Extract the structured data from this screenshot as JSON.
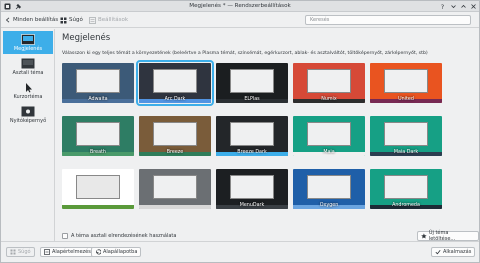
{
  "window": {
    "title": "Megjelenés * — Rendszerbeállítások"
  },
  "toolbar": {
    "back_label": "Minden beállítás",
    "help_label": "Súgó",
    "settings_label": "Beállítások",
    "search_placeholder": "Keresés"
  },
  "sidebar": {
    "items": [
      {
        "label": "Megjelenés",
        "icon": "look-and-feel-icon",
        "selected": true
      },
      {
        "label": "Asztali téma",
        "icon": "desktop-theme-icon",
        "selected": false
      },
      {
        "label": "Kurzortéma",
        "icon": "cursor-icon",
        "selected": false
      },
      {
        "label": "Nyitóképernyő",
        "icon": "splash-screen-icon",
        "selected": false
      }
    ]
  },
  "main": {
    "title": "Megjelenés",
    "description": "Válasszon ki egy teljes témát a környezetének (beleértve a Plasma témát, színsémát, egérkurzort, ablak- és asztalváltót, töltőképernyőt, zárképernyőt, stb)",
    "themes": [
      {
        "name": "Adwaita",
        "bg": "#3c5a78",
        "accent": "#4a6f9a",
        "selected": false
      },
      {
        "name": "Arc Dark",
        "bg": "#2f343f",
        "accent": "#5294e2",
        "selected": true
      },
      {
        "name": "ELPlas",
        "bg": "#1b1e20",
        "accent": "#2a2e32",
        "selected": false
      },
      {
        "name": "Numix",
        "bg": "#d64937",
        "accent": "#2d2d2d",
        "selected": false
      },
      {
        "name": "United",
        "bg": "#e95420",
        "accent": "#772953",
        "selected": false
      },
      {
        "name": "Breath",
        "bg": "#2e7d64",
        "accent": "#4a9a6a",
        "selected": false
      },
      {
        "name": "Breeze",
        "bg": "#7a5c3a",
        "accent": "#2f7d5a",
        "selected": false
      },
      {
        "name": "Breeze Dark",
        "bg": "#232629",
        "accent": "#3daee9",
        "selected": false
      },
      {
        "name": "Maia",
        "bg": "#16a085",
        "accent": "#f0f0f0",
        "selected": false
      },
      {
        "name": "Maia Dark",
        "bg": "#16a085",
        "accent": "#2c3e50",
        "selected": false
      },
      {
        "name": "",
        "bg": "#ffffff",
        "accent": "#5a9a3a",
        "selected": false
      },
      {
        "name": "",
        "bg": "#6b6f73",
        "accent": "#d8d8d8",
        "selected": false
      },
      {
        "name": "MenuDark",
        "bg": "#1c1f22",
        "accent": "#3a3f44",
        "selected": false
      },
      {
        "name": "Oxygen",
        "bg": "#1f5fa8",
        "accent": "#6aa4e0",
        "selected": false
      },
      {
        "name": "Andromeda",
        "bg": "#16a085",
        "accent": "#1d2b36",
        "selected": false
      }
    ],
    "use_layout_label": "A téma asztali elrendezésének használata",
    "get_new_label": "Új téma letöltése..."
  },
  "bottom": {
    "help_label": "Súgó",
    "defaults_label": "Alapértelmezés",
    "reset_label": "Alapállapotba",
    "apply_label": "Alkalmazás"
  },
  "colors": {
    "accent": "#3daee9",
    "background": "#eff0f1"
  }
}
